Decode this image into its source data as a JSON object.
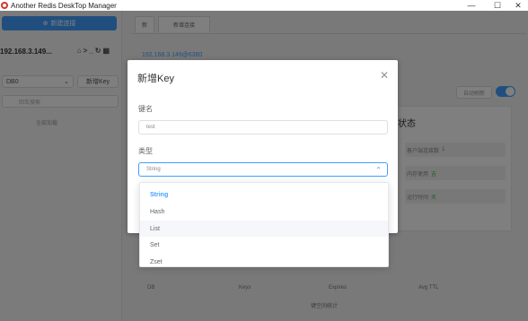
{
  "window": {
    "title": "Another Redis DeskTop Manager",
    "minimize": "—",
    "maximize": "☐",
    "close": "✕"
  },
  "sidebar": {
    "new_connection": "新建连接",
    "connection_name": "192.168.3.149...",
    "db_value": "DB0",
    "new_key": "新增Key",
    "search_placeholder": "回车搜索",
    "load_more": "全部加载"
  },
  "tabs": [
    {
      "label": "新"
    },
    {
      "label": "新增连接"
    }
  ],
  "main": {
    "connection_label": "192.168.3.149@6380",
    "auto_refresh": "自动刷新",
    "status_title": "状态",
    "stats": [
      {
        "label": "客户端连接数",
        "value": "1"
      },
      {
        "label": "内存使用",
        "value": "吉"
      },
      {
        "label": "运行时间",
        "value": "天"
      }
    ],
    "keyspace_headers": [
      "DB",
      "Keys",
      "Expires",
      "Avg TTL"
    ],
    "footer_label": "键空间统计"
  },
  "modal": {
    "title": "新增Key",
    "close_icon": "close-icon",
    "key_label": "键名",
    "key_value": "test",
    "type_label": "类型",
    "type_value": "String"
  },
  "dropdown": {
    "options": [
      "String",
      "Hash",
      "List",
      "Set",
      "Zset"
    ],
    "selected": "String",
    "hovered": "List"
  },
  "colors": {
    "accent": "#409eff",
    "mask": "rgba(0,0,0,0.5)"
  }
}
